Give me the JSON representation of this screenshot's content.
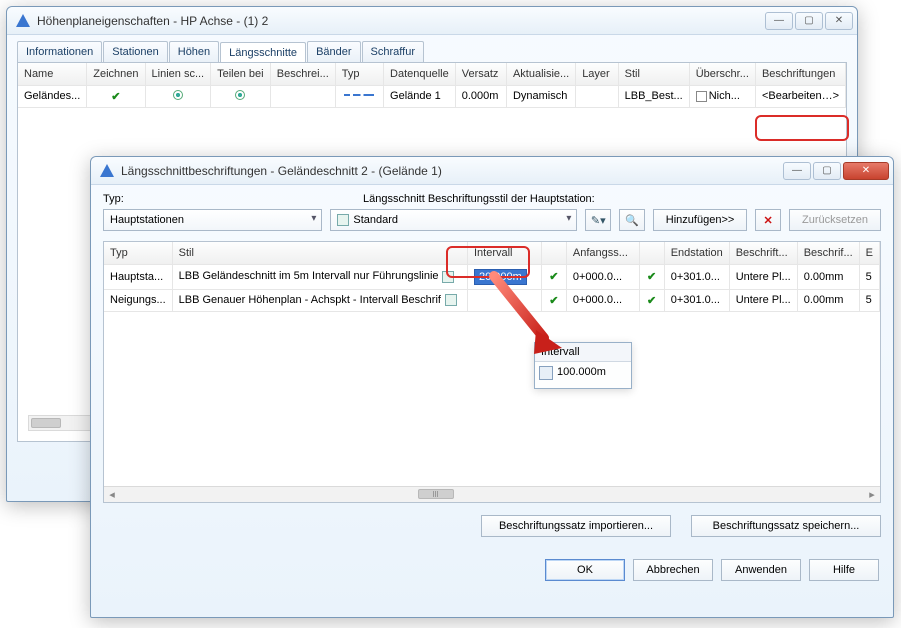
{
  "main_window": {
    "title": "Höhenplaneigenschaften - HP Achse - (1) 2",
    "tabs": [
      "Informationen",
      "Stationen",
      "Höhen",
      "Längsschnitte",
      "Bänder",
      "Schraffur"
    ],
    "active_tab": 3,
    "grid": {
      "headers": [
        "Name",
        "Zeichnen",
        "Linien sc...",
        "Teilen bei",
        "Beschrei...",
        "Typ",
        "Datenquelle",
        "Versatz",
        "Aktualisie...",
        "Layer",
        "Stil",
        "Überschr...",
        "Beschriftungen"
      ],
      "row": {
        "name": "Geländes...",
        "datenquelle": "Gelände 1",
        "versatz": "0.000m",
        "aktual": "Dynamisch",
        "stil": "LBB_Best...",
        "ueberschr": "Nich...",
        "beschrift": "<Bearbeiten…>"
      }
    }
  },
  "inner_window": {
    "title": "Längsschnittbeschriftungen - Geländeschnitt 2 - (Gelände 1)",
    "row1": {
      "typ_label": "Typ:",
      "typ_value": "Hauptstationen",
      "stil_label": "Längsschnitt Beschriftungsstil der Hauptstation:",
      "stil_value": "Standard",
      "hinzuf": "Hinzufügen>>",
      "reset": "Zurücksetzen"
    },
    "grid": {
      "headers": [
        "Typ",
        "Stil",
        "Intervall",
        "",
        "Anfangss...",
        "",
        "Endstation",
        "Beschrift...",
        "Beschrif...",
        "E"
      ],
      "rows": [
        {
          "typ": "Hauptsta...",
          "stil": "LBB Geländeschnitt im 5m Intervall nur Führungslinie",
          "intervall": "20.000m",
          "anf": "0+000.0...",
          "end": "0+301.0...",
          "besch1": "Untere Pl...",
          "besch2": "0.00mm"
        },
        {
          "typ": "Neigungs...",
          "stil": "LBB Genauer Höhenplan - Achspkt - Intervall Beschrif",
          "intervall": "",
          "anf": "0+000.0...",
          "end": "0+301.0...",
          "besch1": "Untere Pl...",
          "besch2": "0.00mm"
        }
      ]
    },
    "float": {
      "header": "Intervall",
      "value": "100.000m"
    },
    "import_btn": "Beschriftungssatz importieren...",
    "save_btn": "Beschriftungssatz speichern...",
    "ok": "OK",
    "cancel": "Abbrechen",
    "apply": "Anwenden",
    "help": "Hilfe"
  },
  "colors": {
    "accent": "#3a76d0",
    "red": "#db2c28"
  }
}
